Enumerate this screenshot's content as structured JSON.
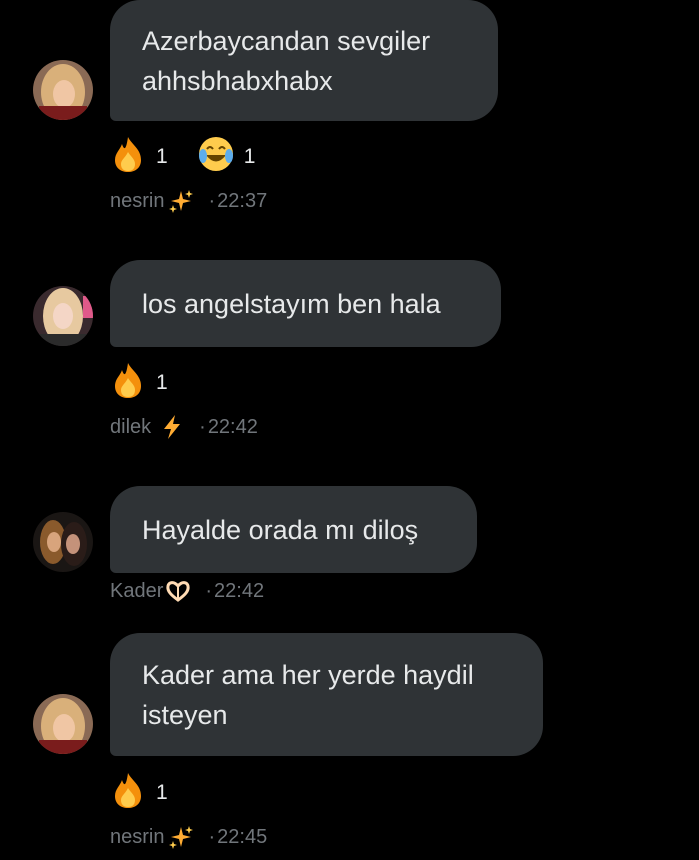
{
  "messages": [
    {
      "lines": [
        "Azerbaycandan sevgiler",
        "ahhsbhabxhabx"
      ],
      "reactions": [
        {
          "emoji": "fire-emoji",
          "count": "1"
        },
        {
          "emoji": "tears-of-joy-emoji",
          "count": "1"
        }
      ],
      "sender": "nesrin",
      "badge": "sparkles-emoji",
      "time": "22:37"
    },
    {
      "lines": [
        "los angelstayım ben hala"
      ],
      "reactions": [
        {
          "emoji": "fire-emoji",
          "count": "1"
        }
      ],
      "sender": "dilek",
      "badge": "lightning-emoji",
      "time": "22:42"
    },
    {
      "lines": [
        "Hayalde orada mı diloş"
      ],
      "reactions": [],
      "sender": "Kader",
      "badge": "heart-hands-emoji",
      "time": "22:42"
    },
    {
      "lines": [
        "Kader ama her yerde haydil",
        "isteyen"
      ],
      "reactions": [
        {
          "emoji": "fire-emoji",
          "count": "1"
        }
      ],
      "sender": "nesrin",
      "badge": "sparkles-emoji",
      "time": "22:45"
    }
  ],
  "time_separator": "·",
  "colors": {
    "background": "#000000",
    "bubble": "#2f3336",
    "text": "#e7e9ea",
    "muted": "#71767b"
  }
}
